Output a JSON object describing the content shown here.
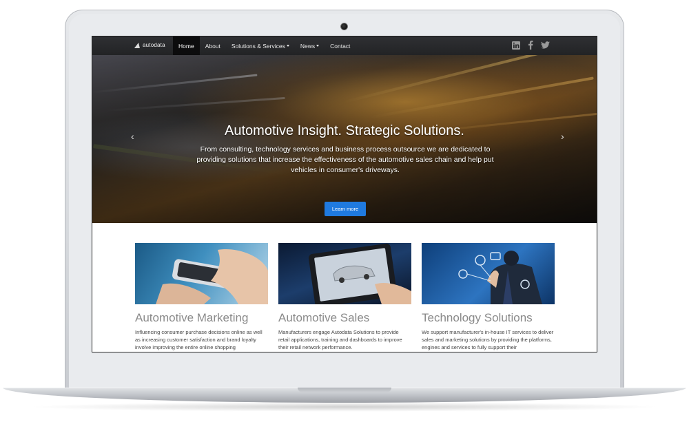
{
  "navbar": {
    "brand": "autodata",
    "items": [
      {
        "label": "Home",
        "active": true,
        "dropdown": false
      },
      {
        "label": "About",
        "active": false,
        "dropdown": false
      },
      {
        "label": "Solutions & Services",
        "active": false,
        "dropdown": true
      },
      {
        "label": "News",
        "active": false,
        "dropdown": true
      },
      {
        "label": "Contact",
        "active": false,
        "dropdown": false
      }
    ],
    "social_icons": [
      "linkedin-icon",
      "facebook-icon",
      "twitter-icon"
    ]
  },
  "hero": {
    "title": "Automotive Insight. Strategic Solutions.",
    "text": "From consulting, technology services and business process outsource we are dedicated to providing solutions that increase the effectiveness of the automotive sales chain and help put vehicles in consumer's driveways.",
    "button_label": "Learn more",
    "prev_arrow": "‹",
    "next_arrow": "›",
    "slides_total": 3,
    "slide_active": 1
  },
  "features": [
    {
      "title": "Automotive Marketing",
      "text": "Influencing consumer purchase decisions online as well as increasing customer satisfaction and brand loyalty involve improving the entire online shopping"
    },
    {
      "title": "Automotive Sales",
      "text": "Manufacturers engage Autodata Solutions to provide retail applications, training and dashboards to improve their retail network performance."
    },
    {
      "title": "Technology Solutions",
      "text": "We support manufacturer's in-house IT services to deliver sales and marketing solutions by providing the platforms, engines and services to fully support their"
    }
  ],
  "colors": {
    "navbar_bg": "#262729",
    "accent_button": "#1f7ae0",
    "feature_title": "#8a8a8a"
  }
}
